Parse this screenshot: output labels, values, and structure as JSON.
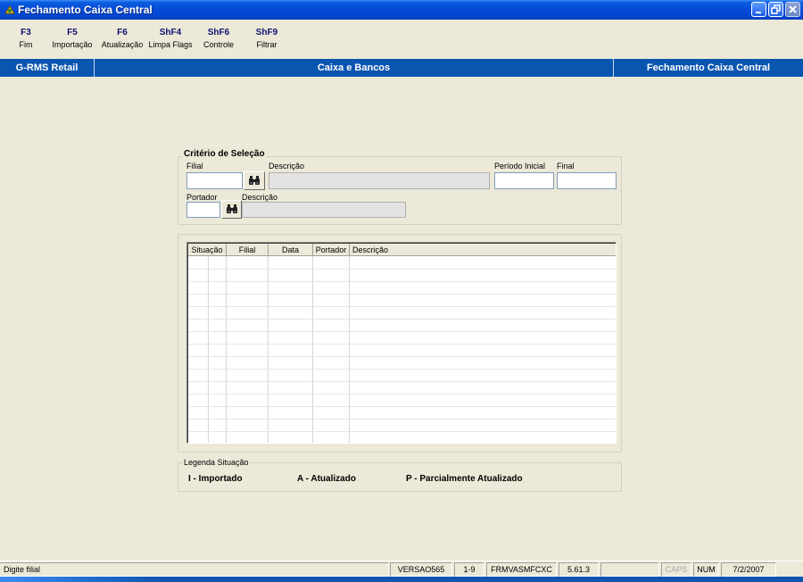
{
  "window": {
    "title": "Fechamento Caixa Central"
  },
  "toolbar": {
    "items": [
      {
        "key": "F3",
        "label": "Fim"
      },
      {
        "key": "F5",
        "label": "Importação"
      },
      {
        "key": "F6",
        "label": "Atualização"
      },
      {
        "key": "ShF4",
        "label": "Limpa Flags"
      },
      {
        "key": "ShF6",
        "label": "Controle"
      },
      {
        "key": "ShF9",
        "label": "Filtrar"
      }
    ]
  },
  "header": {
    "left": "G-RMS Retail",
    "center": "Caixa e Bancos",
    "right": "Fechamento Caixa Central"
  },
  "criteria": {
    "title": "Critério de Seleção",
    "filial_label": "Filial",
    "filial_value": "",
    "descricao1_label": "Descrição",
    "descricao1_value": "",
    "periodo_inicial_label": "Período Inicial",
    "periodo_inicial_value": "",
    "final_label": "Final",
    "final_value": "",
    "portador_label": "Portador",
    "portador_value": "",
    "descricao2_label": "Descrição",
    "descricao2_value": ""
  },
  "grid": {
    "columns": [
      "Situação",
      "Filial",
      "Data",
      "Portador",
      "Descrição"
    ],
    "rows": []
  },
  "legend": {
    "title": "Legenda Situação",
    "items": [
      "I - Importado",
      "A - Atualizado",
      "P - Parcialmente Atualizado"
    ]
  },
  "status": {
    "message": "Digite filial",
    "version": "VERSAO565",
    "page": "1-9",
    "form": "FRMVASMFCXC",
    "build": "5.61.3",
    "empty": "",
    "caps": "CAPS",
    "num": "NUM",
    "date": "7/2/2007"
  },
  "colors": {
    "titlebar": "#0549d6",
    "header_bar": "#0a55b0",
    "background": "#ece9d8"
  }
}
